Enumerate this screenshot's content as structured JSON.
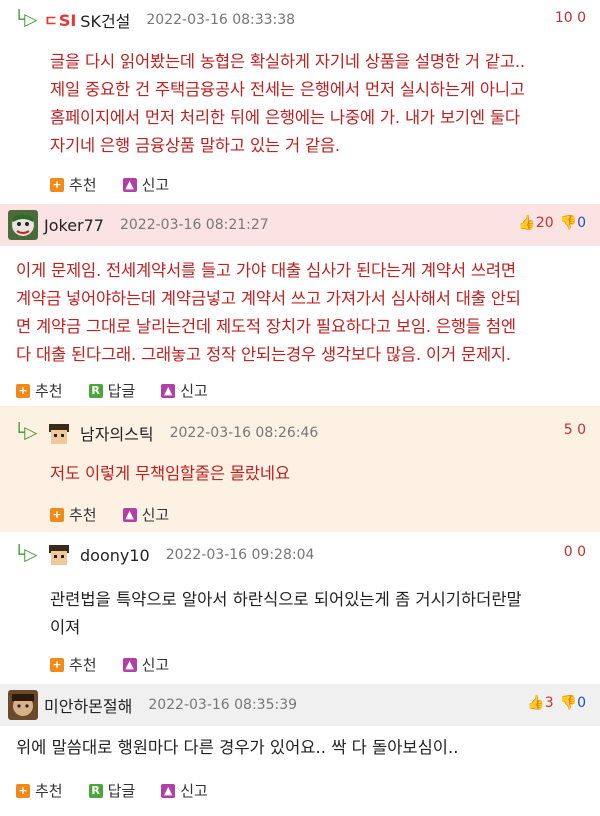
{
  "c1": {
    "brand": "SK건설",
    "logo": "SI",
    "date": "2022-03-16 08:33:38",
    "score": "10 0",
    "lines": [
      "글을 다시 읽어봤는데 농협은 확실하게 자기네 상품을 설명한 거 같고..",
      "제일 중요한 건 주택금융공사 전세는 은행에서 먼저 실시하는게 아니고",
      "홈페이지에서 먼저 처리한 뒤에 은행에는 나중에 가. 내가 보기엔 둘다",
      "자기네 은행 금융상품 말하고 있는 거 같음."
    ],
    "recommend": "추천",
    "report": "신고"
  },
  "c2": {
    "nick": "Joker77",
    "date": "2022-03-16 08:21:27",
    "up": "20",
    "down": "0",
    "lines": [
      "이게 문제임. 전세계약서를 들고 가야 대출 심사가 된다는게 계약서 쓰려면",
      "계약금 넣어야하는데 계약금넣고 계약서 쓰고 가져가서 심사해서 대출 안되",
      "면 계약금 그대로 날리는건데 제도적 장치가 필요하다고 보임. 은행들 첨엔",
      "다 대출 된다그래. 그래놓고 정작 안되는경우 생각보다 많음. 이거 문제지."
    ],
    "recommend": "추천",
    "reply": "답글",
    "report": "신고"
  },
  "c3": {
    "nick": "남자의스틱",
    "date": "2022-03-16 08:26:46",
    "score": "5 0",
    "lines": [
      "저도 이렇게 무책임할줄은 몰랐네요"
    ],
    "recommend": "추천",
    "report": "신고"
  },
  "c4": {
    "nick": "doony10",
    "date": "2022-03-16 09:28:04",
    "score": "0 0",
    "lines": [
      "관련법을 특약으로 알아서 하란식으로 되어있는게 좀 거시기하더란말",
      "이져"
    ],
    "recommend": "추천",
    "report": "신고"
  },
  "c5": {
    "nick": "미안하몬절해",
    "date": "2022-03-16 08:35:39",
    "up": "3",
    "down": "0",
    "lines": [
      "위에 말씀대로 행원마다 다른 경우가 있어요.. 싹 다 돌아보심이.."
    ],
    "recommend": "추천",
    "reply": "답글",
    "report": "신고"
  },
  "colors": {
    "red_text": "#c02020",
    "pink_bg": "#fbe3e3",
    "beige_bg": "#fdf1e4",
    "reply_arrow": "#3a9a2a"
  }
}
